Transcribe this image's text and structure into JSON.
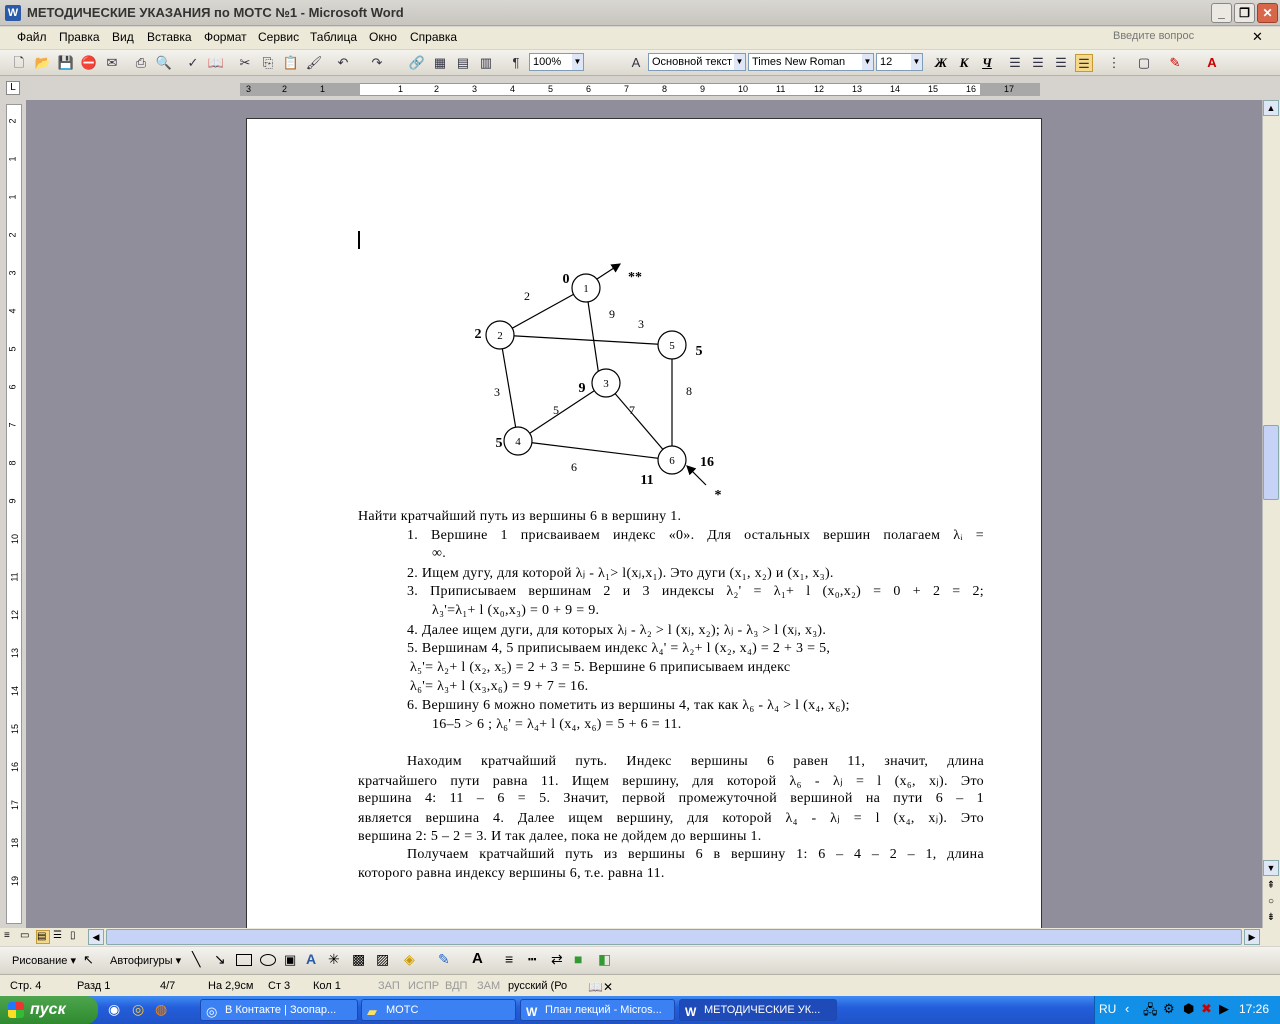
{
  "window": {
    "title": "МЕТОДИЧЕСКИЕ УКАЗАНИЯ по МОТС №1 - Microsoft Word",
    "app_icon": "W"
  },
  "menu": {
    "items": [
      "Файл",
      "Правка",
      "Вид",
      "Вставка",
      "Формат",
      "Сервис",
      "Таблица",
      "Окно",
      "Справка"
    ],
    "help_placeholder": "Введите вопрос"
  },
  "toolbar": {
    "zoom": "100%",
    "style": "Основной текст",
    "font": "Times New Roman",
    "size": "12",
    "bold": "Ж",
    "italic": "К",
    "underline": "Ч"
  },
  "ruler": {
    "h_ticks": [
      "3",
      "2",
      "1",
      "1",
      "2",
      "3",
      "4",
      "5",
      "6",
      "7",
      "8",
      "9",
      "10",
      "11",
      "12",
      "13",
      "14",
      "15",
      "16",
      "17"
    ],
    "v_ticks": [
      "2",
      "1",
      "1",
      "2",
      "3",
      "4",
      "5",
      "6",
      "7",
      "8",
      "9",
      "10",
      "11",
      "12",
      "13",
      "14",
      "15",
      "16",
      "17",
      "18",
      "19"
    ]
  },
  "graph": {
    "nodes": [
      {
        "id": "1",
        "index": "0"
      },
      {
        "id": "2",
        "index": "2"
      },
      {
        "id": "3",
        "index": "9"
      },
      {
        "id": "4",
        "index": "5"
      },
      {
        "id": "5",
        "index": "5"
      },
      {
        "id": "6",
        "index": "16"
      }
    ],
    "edges": [
      {
        "from": "1",
        "to": "2",
        "weight": "2"
      },
      {
        "from": "1",
        "to": "3",
        "weight": "9"
      },
      {
        "from": "2",
        "to": "5",
        "weight": "3"
      },
      {
        "from": "2",
        "to": "4",
        "weight": "3"
      },
      {
        "from": "3",
        "to": "4",
        "weight": "5"
      },
      {
        "from": "3",
        "to": "6",
        "weight": "7"
      },
      {
        "from": "5",
        "to": "6",
        "weight": "8"
      },
      {
        "from": "4",
        "to": "6",
        "weight": "6"
      }
    ],
    "extra_labels": {
      "start_marks": "**",
      "end_marks": "*",
      "eleven": "11"
    }
  },
  "doc": {
    "task": "Найти кратчайший путь из вершины 6 в вершину 1.",
    "s1a": "1.   Вершине 1 присваиваем индекс «0». Для остальных вершин полагаем λᵢ =",
    "s1b": "∞.",
    "s2": "2.   Ищем дугу, для которой  λⱼ - λ₁> l(xⱼ,x₁). Это дуги (x₁, x₂) и (x₁, x₃).",
    "s3a": "3.   Приписываем вершинам 2 и 3 индексы  λ₂' =  λ₁+ l (x₀,x₂) = 0 + 2 = 2;",
    "s3b": "λ₃'=λ₁+ l (x₀,x₃) = 0 + 9 = 9.",
    "s4": "4.    Далее ищем дуги, для которых  λⱼ - λ₂ > l (xⱼ, x₂); λⱼ - λ₃ > l (xⱼ, x₃).",
    "s5a": "5.   Вершинам 4, 5 приписываем индекс  λ₄' = λ₂+ l (x₂, x₄) = 2 + 3 = 5,",
    "s5b": "λ₅'= λ₂+ l (x₂, x₅) = 2 + 3 = 5. Вершине 6 приписываем индекс",
    "s5c": "λ₆'= λ₃+ l (x₃,x₆) = 9 + 7 = 16.",
    "s6a": "6.   Вершину 6 можно пометить из вершины 4, так как  λ₆ - λ₄ > l (x₄, x₆);",
    "s6b": "16–5 > 6 ;  λ₆' = λ₄+ l (x₄, x₆) = 5 + 6 = 11.",
    "p1a": "Находим кратчайший путь. Индекс вершины 6 равен 11, значит, длина",
    "p1b": "кратчайшего пути равна 11. Ищем вершину, для которой  λ₆ - λⱼ = l (x₆, xⱼ). Это",
    "p1c": "вершина 4: 11 – 6 = 5. Значит, первой промежуточной вершиной на пути 6 – 1",
    "p1d": "является вершина 4. Далее ищем вершину, для которой  λ₄ - λⱼ = l (x₄, xⱼ). Это",
    "p1e": "вершина 2: 5 – 2 = 3. И так далее, пока не дойдем до вершины 1.",
    "p2a": "Получаем кратчайший путь из вершины 6 в вершину 1: 6 – 4 – 2 – 1, длина",
    "p2b": "которого равна индексу вершины 6, т.е. равна 11."
  },
  "drawbar": {
    "drawing": "Рисование ▾",
    "autoshapes": "Автофигуры ▾"
  },
  "status": {
    "page": "Стр. 4",
    "section": "Разд 1",
    "pages": "4/7",
    "at": "На 2,9см",
    "line": "Ст 3",
    "col": "Кол 1",
    "rec": "ЗАП",
    "trk": "ИСПР",
    "ext": "ВДП",
    "ovr": "ЗАМ",
    "lang": "русский (Ро"
  },
  "taskbar": {
    "start": "пуск",
    "tasks": [
      "В Контакте | Зоопар...",
      "МОТС",
      "План лекций - Micros...",
      "МЕТОДИЧЕСКИЕ УК..."
    ],
    "lang": "RU",
    "time": "17:26"
  }
}
